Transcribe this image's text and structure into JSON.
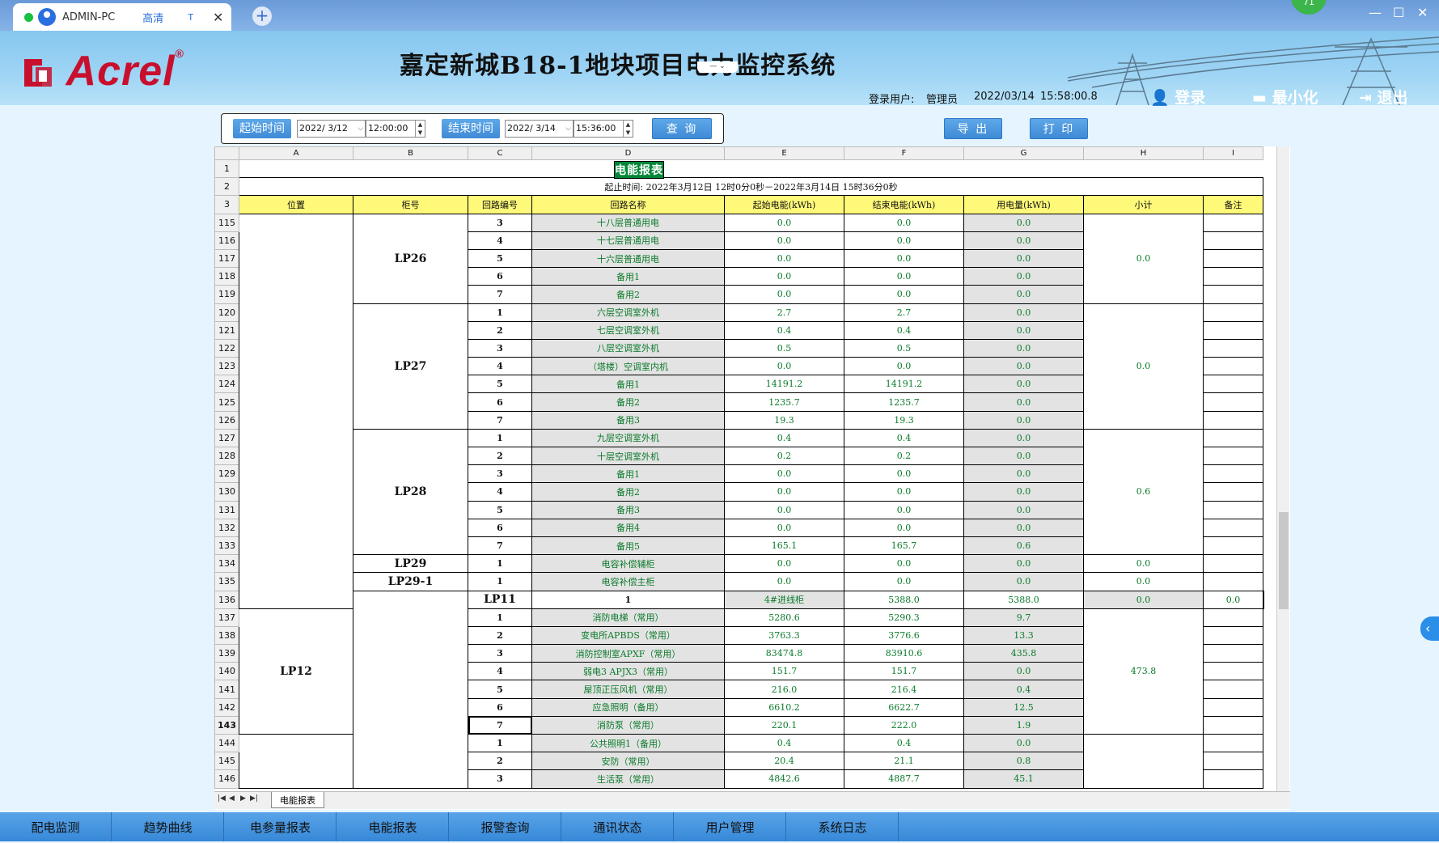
{
  "browser": {
    "tab_host": "ADMIN-PC",
    "tab_quality": "高清",
    "tab_t": "T",
    "tab_close": "✕",
    "new_tab": "+",
    "badge": "71",
    "min": "—",
    "max": "☐",
    "close": "✕"
  },
  "header": {
    "logo_text": "Acrel",
    "logo_reg": "®",
    "title": "嘉定新城B18-1地块项目电力监控系统",
    "drop_btn": "— ⌄",
    "login_user_label": "登录用户:",
    "login_user": "管理员",
    "date": "2022/03/14",
    "time": "15:58:00.8",
    "login_btn": "登录",
    "minimize_btn": "最小化",
    "exit_btn": "退出"
  },
  "query": {
    "start_label": "起始时间",
    "start_date": "2022/ 3/12",
    "start_time": "12:00:00",
    "end_label": "结束时间",
    "end_date": "2022/ 3/14",
    "end_time": "15:36:00",
    "query_btn": "查 询",
    "export_btn": "导 出",
    "print_btn": "打 印"
  },
  "sheet": {
    "col_letters": [
      "A",
      "B",
      "C",
      "D",
      "E",
      "F",
      "G",
      "H",
      "I"
    ],
    "title": "电能报表",
    "period": "起止时间: 2022年3月12日 12时0分0秒－2022年3月14日 15时36分0秒",
    "headers": [
      "位置",
      "柜号",
      "回路编号",
      "回路名称",
      "起始电能(kWh)",
      "结束电能(kWh)",
      "用电量(kWh)",
      "小计",
      "备注"
    ],
    "row_nums": [
      "1",
      "2",
      "3",
      "115",
      "116",
      "117",
      "118",
      "119",
      "120",
      "121",
      "122",
      "123",
      "124",
      "125",
      "126",
      "127",
      "128",
      "129",
      "130",
      "131",
      "132",
      "133",
      "134",
      "135",
      "136",
      "137",
      "138",
      "139",
      "140",
      "141",
      "142",
      "143",
      "144",
      "145",
      "146"
    ],
    "groups": [
      {
        "cab": "LP26",
        "subtotal": "0.0",
        "rows": [
          [
            "3",
            "十八层普通用电",
            "0.0",
            "0.0",
            "0.0"
          ],
          [
            "4",
            "十七层普通用电",
            "0.0",
            "0.0",
            "0.0"
          ],
          [
            "5",
            "十六层普通用电",
            "0.0",
            "0.0",
            "0.0"
          ],
          [
            "6",
            "备用1",
            "0.0",
            "0.0",
            "0.0"
          ],
          [
            "7",
            "备用2",
            "0.0",
            "0.0",
            "0.0"
          ]
        ]
      },
      {
        "cab": "LP27",
        "subtotal": "0.0",
        "rows": [
          [
            "1",
            "六层空调室外机",
            "2.7",
            "2.7",
            "0.0"
          ],
          [
            "2",
            "七层空调室外机",
            "0.4",
            "0.4",
            "0.0"
          ],
          [
            "3",
            "八层空调室外机",
            "0.5",
            "0.5",
            "0.0"
          ],
          [
            "4",
            "（塔楼）空调室内机",
            "0.0",
            "0.0",
            "0.0"
          ],
          [
            "5",
            "备用1",
            "14191.2",
            "14191.2",
            "0.0"
          ],
          [
            "6",
            "备用2",
            "1235.7",
            "1235.7",
            "0.0"
          ],
          [
            "7",
            "备用3",
            "19.3",
            "19.3",
            "0.0"
          ]
        ]
      },
      {
        "cab": "LP28",
        "subtotal": "0.6",
        "rows": [
          [
            "1",
            "九层空调室外机",
            "0.4",
            "0.4",
            "0.0"
          ],
          [
            "2",
            "十层空调室外机",
            "0.2",
            "0.2",
            "0.0"
          ],
          [
            "3",
            "备用1",
            "0.0",
            "0.0",
            "0.0"
          ],
          [
            "4",
            "备用2",
            "0.0",
            "0.0",
            "0.0"
          ],
          [
            "5",
            "备用3",
            "0.0",
            "0.0",
            "0.0"
          ],
          [
            "6",
            "备用4",
            "0.0",
            "0.0",
            "0.0"
          ],
          [
            "7",
            "备用5",
            "165.1",
            "165.7",
            "0.6"
          ]
        ]
      },
      {
        "cab": "LP29",
        "subtotal": "0.0",
        "rows": [
          [
            "1",
            "电容补偿辅柜",
            "0.0",
            "0.0",
            "0.0"
          ]
        ]
      },
      {
        "cab": "LP29-1",
        "subtotal": "0.0",
        "rows": [
          [
            "1",
            "电容补偿主柜",
            "0.0",
            "0.0",
            "0.0"
          ]
        ]
      },
      {
        "cab": "LP11",
        "subtotal": "0.0",
        "rows": [
          [
            "1",
            "4#进线柜",
            "5388.0",
            "5388.0",
            "0.0"
          ]
        ]
      },
      {
        "cab": "LP12",
        "subtotal": "473.8",
        "rows": [
          [
            "1",
            "消防电梯（常用）",
            "5280.6",
            "5290.3",
            "9.7"
          ],
          [
            "2",
            "变电所APBDS（常用）",
            "3763.3",
            "3776.6",
            "13.3"
          ],
          [
            "3",
            "消防控制室APXF（常用）",
            "83474.8",
            "83910.6",
            "435.8"
          ],
          [
            "4",
            "弱电3 APJX3（常用）",
            "151.7",
            "151.7",
            "0.0"
          ],
          [
            "5",
            "屋顶正压风机（常用）",
            "216.0",
            "216.4",
            "0.4"
          ],
          [
            "6",
            "应急照明（备用）",
            "6610.2",
            "6622.7",
            "12.5"
          ],
          [
            "7",
            "消防泵（常用）",
            "220.1",
            "222.0",
            "1.9"
          ]
        ]
      },
      {
        "cab": "",
        "subtotal": "",
        "rows": [
          [
            "1",
            "公共照明1（备用）",
            "0.4",
            "0.4",
            "0.0"
          ],
          [
            "2",
            "安防（常用）",
            "20.4",
            "21.1",
            "0.8"
          ],
          [
            "3",
            "生活泵（常用）",
            "4842.6",
            "4887.7",
            "45.1"
          ]
        ]
      }
    ],
    "sheet_tab": "电能报表"
  },
  "nav": [
    "配电监测",
    "趋势曲线",
    "电参量报表",
    "电能报表",
    "报警查询",
    "通讯状态",
    "用户管理",
    "系统日志"
  ]
}
